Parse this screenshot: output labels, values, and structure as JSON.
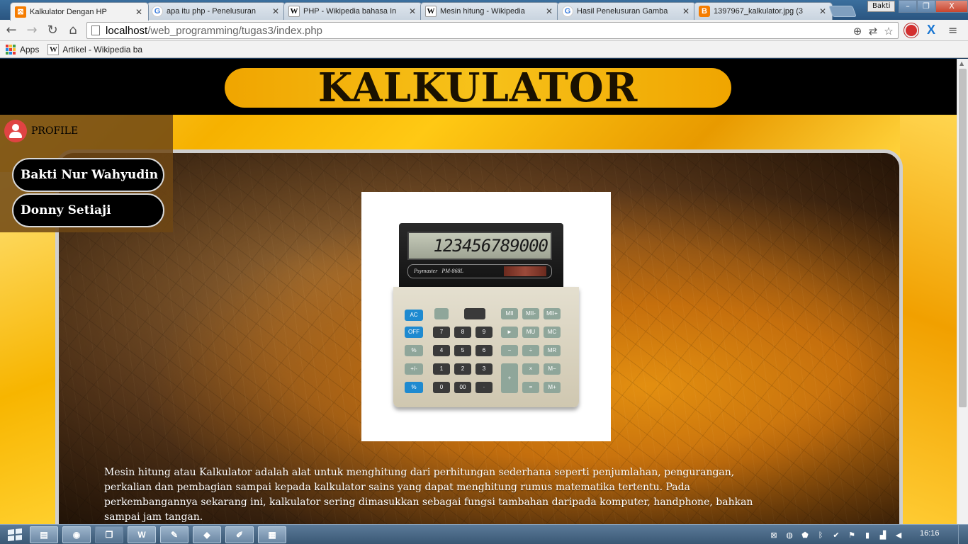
{
  "browser": {
    "tabs": [
      {
        "title": "Kalkulator Dengan HP",
        "favicon": "xampp-icon",
        "active": true
      },
      {
        "title": "apa itu php - Penelusuran",
        "favicon": "google-icon",
        "active": false
      },
      {
        "title": "PHP - Wikipedia bahasa In",
        "favicon": "wikipedia-icon",
        "active": false
      },
      {
        "title": "Mesin hitung - Wikipedia",
        "favicon": "wikipedia-icon",
        "active": false
      },
      {
        "title": "Hasil Penelusuran Gamba",
        "favicon": "google-icon",
        "active": false
      },
      {
        "title": "1397967_kalkulator.jpg (3",
        "favicon": "blogger-icon",
        "active": false
      }
    ],
    "close_glyph": "✕",
    "user_badge": "Bakti",
    "window_buttons": {
      "minimize": "–",
      "maximize": "❐",
      "close": "X"
    },
    "url_host": "localhost",
    "url_path": "/web_programming/tugas3/index.php",
    "bookmarks": {
      "apps_label": "Apps",
      "items": [
        {
          "label": "Artikel - Wikipedia ba"
        }
      ]
    }
  },
  "page": {
    "title": "KALKULATOR",
    "profile_label": "PROFILE",
    "members": [
      "Bakti Nur Wahyudin",
      "Donny Setiaji"
    ],
    "calculator_display": "123456789000",
    "calculator_brand": "PM-868L",
    "description": "Mesin hitung atau Kalkulator adalah alat untuk menghitung dari perhitungan sederhana seperti penjumlahan, pengurangan, perkalian dan pembagian sampai kepada kalkulator sains yang dapat menghitung rumus matematika tertentu. Pada perkembangannya sekarang ini, kalkulator sering dimasukkan sebagai fungsi tambahan daripada komputer, handphone, bahkan sampai jam tangan."
  },
  "taskbar": {
    "clock": "16:16",
    "apps": [
      "file-explorer-icon",
      "chrome-icon",
      "file-manager-icon",
      "word-icon",
      "paint-icon",
      "virtualbox-icon",
      "notepad-icon",
      "notes-icon"
    ]
  },
  "colors": {
    "header": "#000000",
    "title_pill": "#f7b30d",
    "background": "#f5b400",
    "profile_icon": "#e04343"
  }
}
